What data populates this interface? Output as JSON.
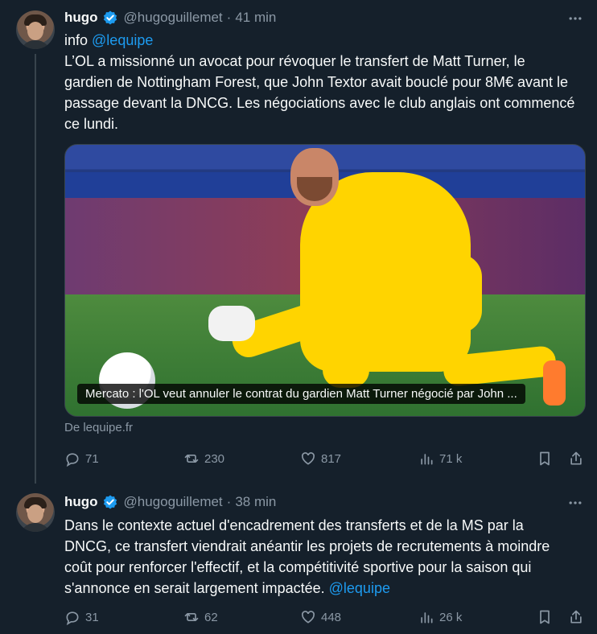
{
  "tweets": [
    {
      "name": "hugo",
      "handle": "@hugoguillemet",
      "dot": "·",
      "time": "41 min",
      "text_prefix": "info ",
      "mention": "@lequipe",
      "body": "L’OL a missionné un avocat pour révoquer le transfert de Matt Turner, le gardien de Nottingham Forest, que John Textor avait bouclé pour 8M€ avant le passage devant la DNCG. Les négociations avec le club anglais ont commencé ce lundi.",
      "card_caption": "Mercato : l'OL veut annuler le contrat du gardien Matt Turner négocié par John ...",
      "source": "De lequipe.fr",
      "replies": "71",
      "reposts": "230",
      "likes": "817",
      "views": "71 k"
    },
    {
      "name": "hugo",
      "handle": "@hugoguillemet",
      "dot": "·",
      "time": "38 min",
      "body": "Dans le contexte actuel d'encadrement des transferts et de la MS par la DNCG, ce transfert viendrait anéantir les projets de recrutements à moindre coût pour renforcer l'effectif, et la compétitivité sportive pour la saison qui s'annonce en serait largement impactée.",
      "mention": "@lequipe",
      "replies": "31",
      "reposts": "62",
      "likes": "448",
      "views": "26 k"
    }
  ],
  "icons": {
    "verified": "verified-badge-icon",
    "more": "more-options-icon",
    "reply": "reply-icon",
    "repost": "repost-icon",
    "like": "like-icon",
    "views": "views-icon",
    "bookmark": "bookmark-icon",
    "share": "share-icon"
  },
  "colors": {
    "background": "#15202b",
    "text": "#f7f9f9",
    "muted": "#8b98a5",
    "accent": "#1d9bf0",
    "divider": "#38444d"
  }
}
